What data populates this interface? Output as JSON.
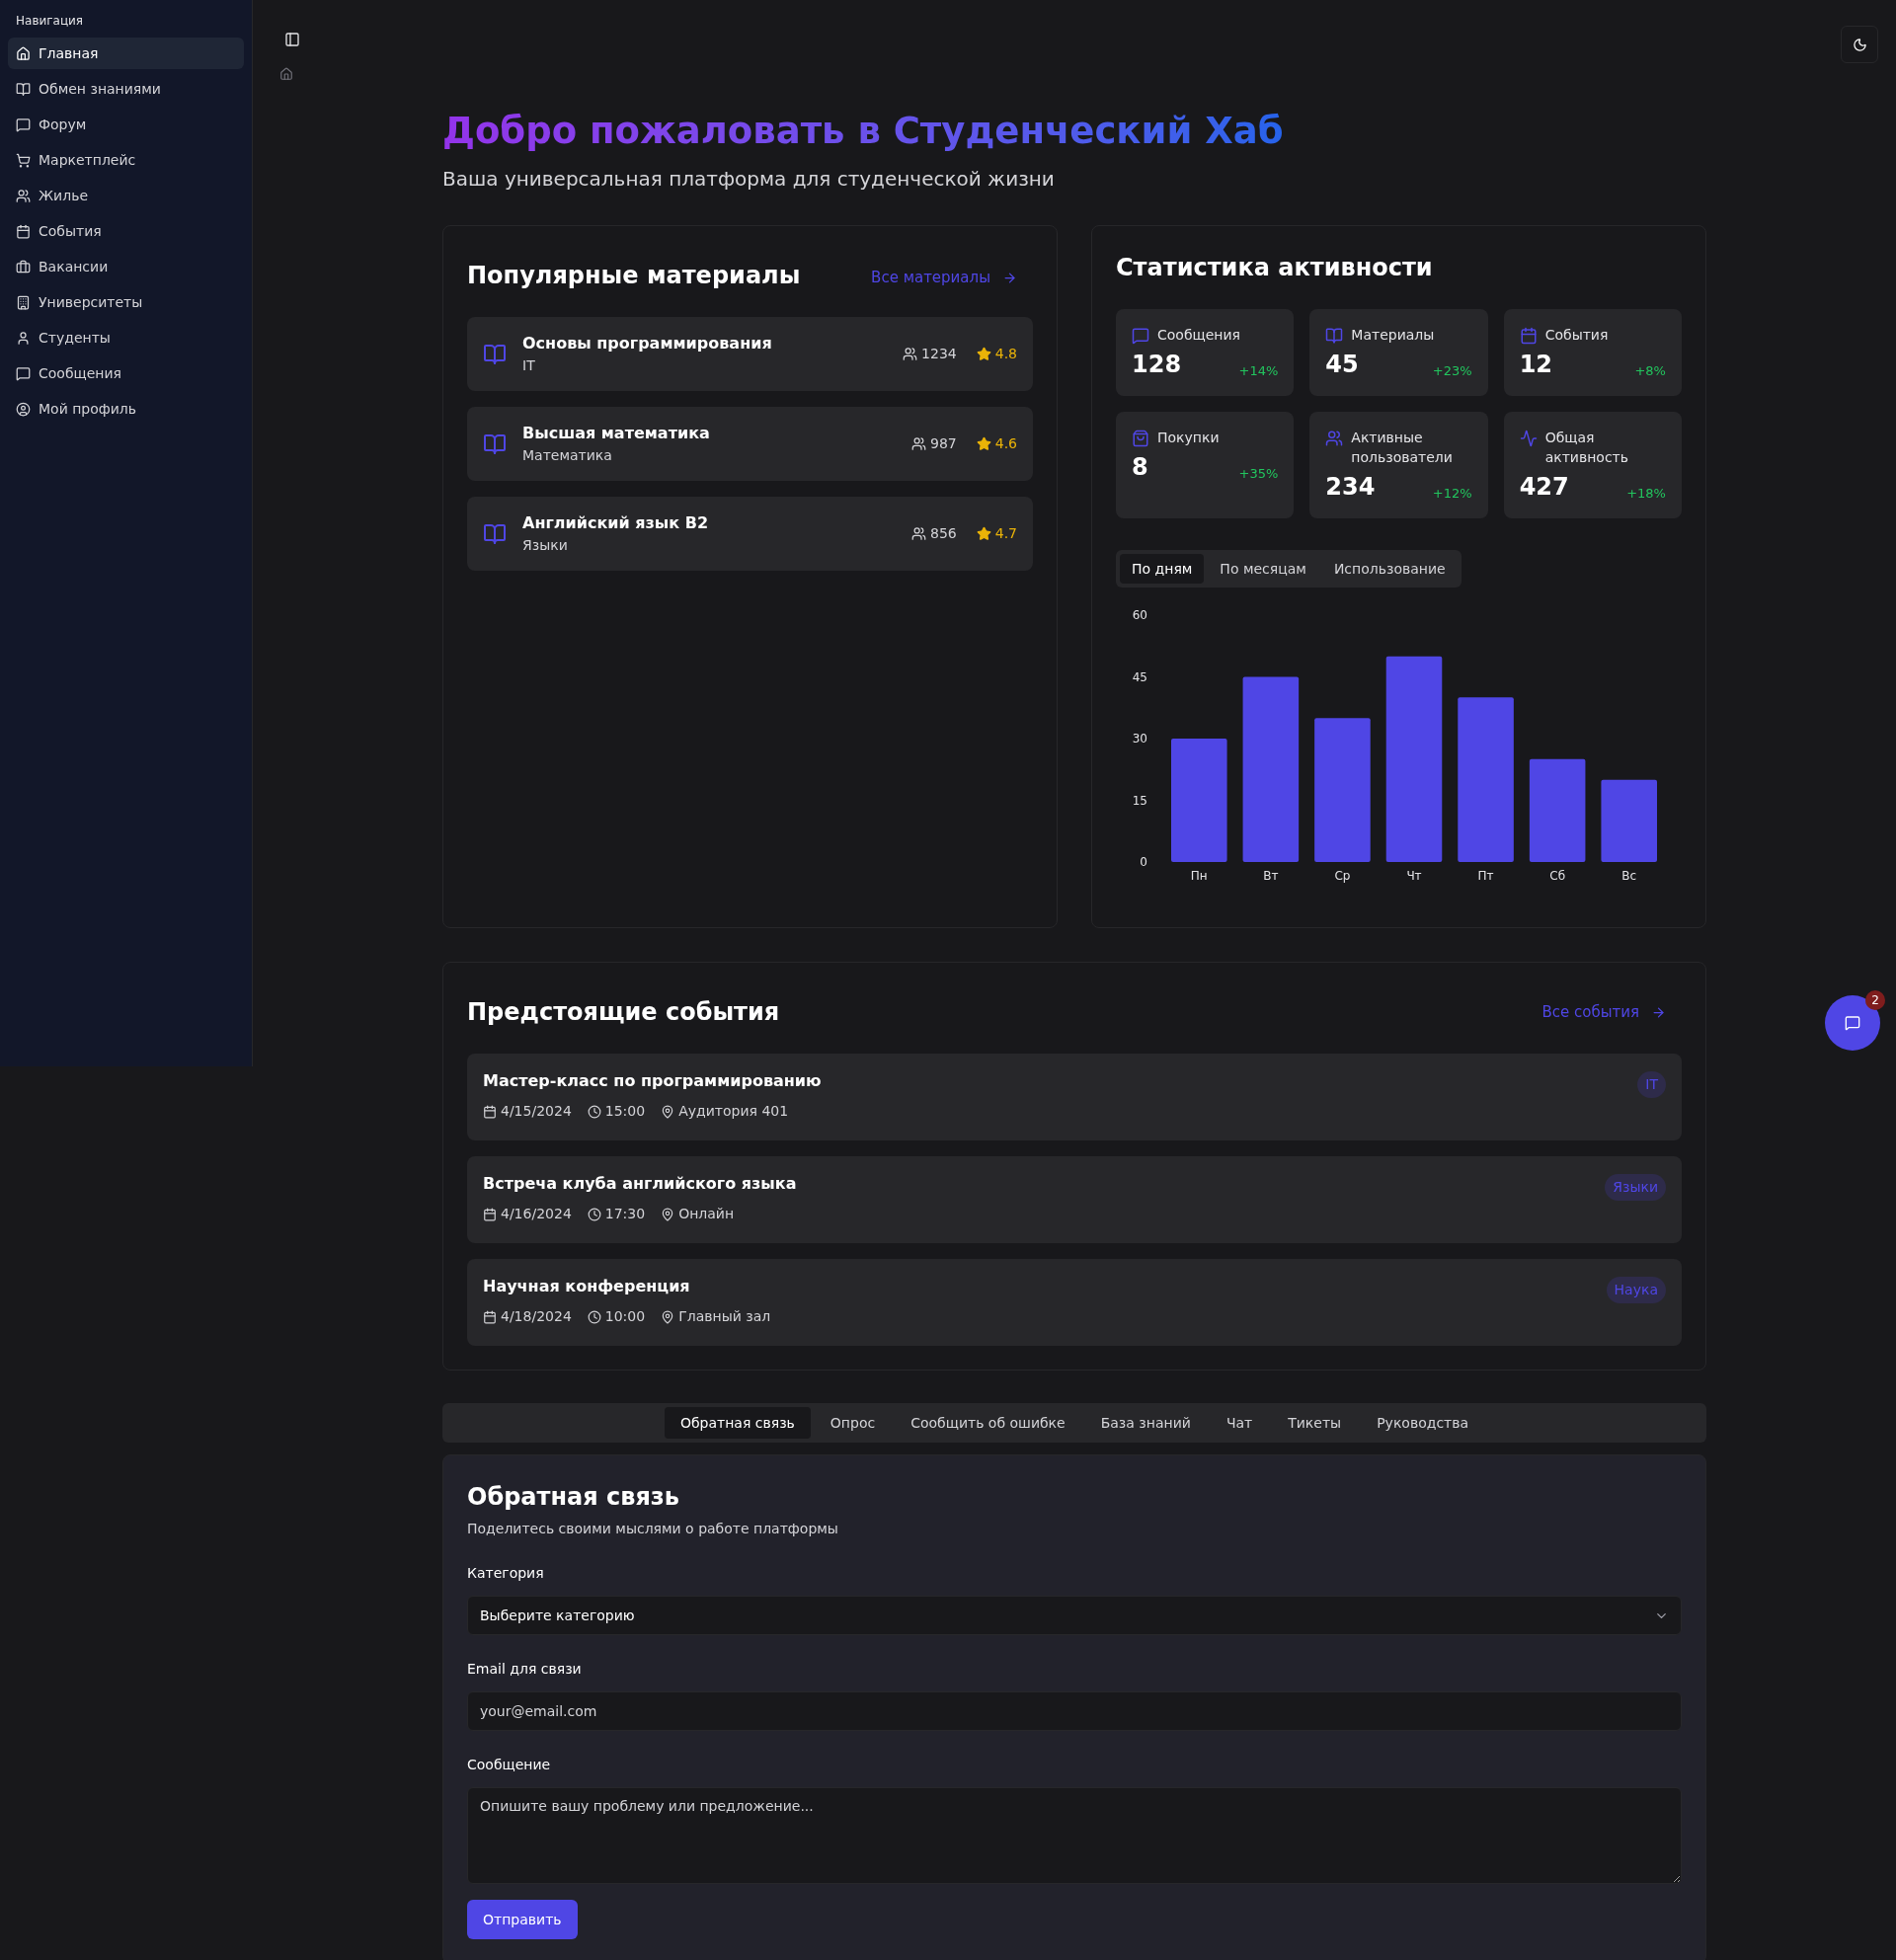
{
  "sidebar": {
    "heading": "Навигация",
    "items": [
      {
        "label": "Главная",
        "selected": true
      },
      {
        "label": "Обмен знаниями",
        "selected": false
      },
      {
        "label": "Форум",
        "selected": false
      },
      {
        "label": "Маркетплейс",
        "selected": false
      },
      {
        "label": "Жилье",
        "selected": false
      },
      {
        "label": "События",
        "selected": false
      },
      {
        "label": "Вакансии",
        "selected": false
      },
      {
        "label": "Университеты",
        "selected": false
      },
      {
        "label": "Студенты",
        "selected": false
      },
      {
        "label": "Сообщения",
        "selected": false
      },
      {
        "label": "Мой профиль",
        "selected": false
      }
    ]
  },
  "header": {
    "title": "Добро пожаловать в Студенческий Хаб",
    "subtitle": "Ваша универсальная платформа для студенческой жизни"
  },
  "materials": {
    "title": "Популярные материалы",
    "link": "Все материалы",
    "items": [
      {
        "title": "Основы программирования",
        "category": "IT",
        "users": "1234",
        "rating": "4.8"
      },
      {
        "title": "Высшая математика",
        "category": "Математика",
        "users": "987",
        "rating": "4.6"
      },
      {
        "title": "Английский язык B2",
        "category": "Языки",
        "users": "856",
        "rating": "4.7"
      }
    ]
  },
  "stats": {
    "title": "Статистика активности",
    "tiles": [
      {
        "label": "Сообщения",
        "value": "128",
        "change": "+14%"
      },
      {
        "label": "Материалы",
        "value": "45",
        "change": "+23%"
      },
      {
        "label": "События",
        "value": "12",
        "change": "+8%"
      },
      {
        "label": "Покупки",
        "value": "8",
        "change": "+35%"
      },
      {
        "label": "Активные пользователи",
        "value": "234",
        "change": "+12%"
      },
      {
        "label": "Общая активность",
        "value": "427",
        "change": "+18%"
      }
    ],
    "tabs": [
      {
        "label": "По дням",
        "selected": true
      },
      {
        "label": "По месяцам",
        "selected": false
      },
      {
        "label": "Использование",
        "selected": false
      }
    ],
    "chart_data": {
      "type": "bar",
      "categories": [
        "Пн",
        "Вт",
        "Ср",
        "Чт",
        "Пт",
        "Сб",
        "Вс"
      ],
      "series": [
        {
          "color": "#4f46e5",
          "values": [
            30,
            45,
            35,
            50,
            40,
            25,
            20
          ]
        }
      ],
      "ylim": [
        0,
        60
      ],
      "yticks": [
        0,
        15,
        30,
        45,
        60
      ]
    }
  },
  "events": {
    "title": "Предстоящие события",
    "link": "Все события",
    "items": [
      {
        "title": "Мастер-класс по программированию",
        "date": "4/15/2024",
        "time": "15:00",
        "place": "Аудитория 401",
        "tag": "IT"
      },
      {
        "title": "Встреча клуба английского языка",
        "date": "4/16/2024",
        "time": "17:30",
        "place": "Онлайн",
        "tag": "Языки"
      },
      {
        "title": "Научная конференция",
        "date": "4/18/2024",
        "time": "10:00",
        "place": "Главный зал",
        "tag": "Наука"
      }
    ]
  },
  "support_tabs": [
    {
      "label": "Обратная связь",
      "selected": true
    },
    {
      "label": "Опрос",
      "selected": false
    },
    {
      "label": "Сообщить об ошибке",
      "selected": false
    },
    {
      "label": "База знаний",
      "selected": false
    },
    {
      "label": "Чат",
      "selected": false
    },
    {
      "label": "Тикеты",
      "selected": false
    },
    {
      "label": "Руководства",
      "selected": false
    }
  ],
  "feedback": {
    "title": "Обратная связь",
    "description": "Поделитесь своими мыслями о работе платформы",
    "fields": [
      {
        "kind": "select",
        "label": "Категория",
        "value": "Выберите категорию"
      },
      {
        "kind": "input",
        "label": "Email для связи",
        "placeholder": "your@email.com"
      },
      {
        "kind": "textarea",
        "label": "Сообщение",
        "placeholder": "Опишите вашу проблему или предложение..."
      }
    ],
    "submit": "Отправить"
  },
  "chat_button": {
    "badge": "2"
  }
}
